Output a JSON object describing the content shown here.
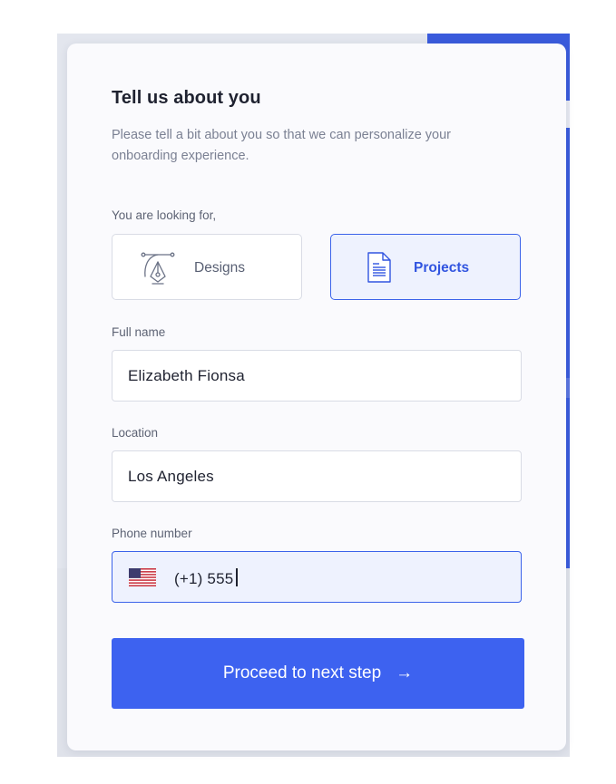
{
  "form": {
    "title": "Tell us about you",
    "subtitle": "Please tell a bit about you so that we can personalize your onboarding experience.",
    "looking_for_label": "You are looking for,",
    "options": [
      {
        "label": "Designs",
        "icon": "pen-tool-icon",
        "selected": false
      },
      {
        "label": "Projects",
        "icon": "document-icon",
        "selected": true
      }
    ],
    "full_name": {
      "label": "Full name",
      "value": "Elizabeth Fionsa"
    },
    "location": {
      "label": "Location",
      "value": "Los Angeles"
    },
    "phone": {
      "label": "Phone number",
      "value": "(+1) 555",
      "country_flag": "us-flag-icon"
    },
    "submit": {
      "label": "Proceed to next step",
      "arrow": "→"
    }
  },
  "colors": {
    "accent": "#3d62f0",
    "selected_border": "#3b63ea",
    "selected_bg": "#eef2fe",
    "text_primary": "#1f2230",
    "text_muted": "#7b8193"
  }
}
